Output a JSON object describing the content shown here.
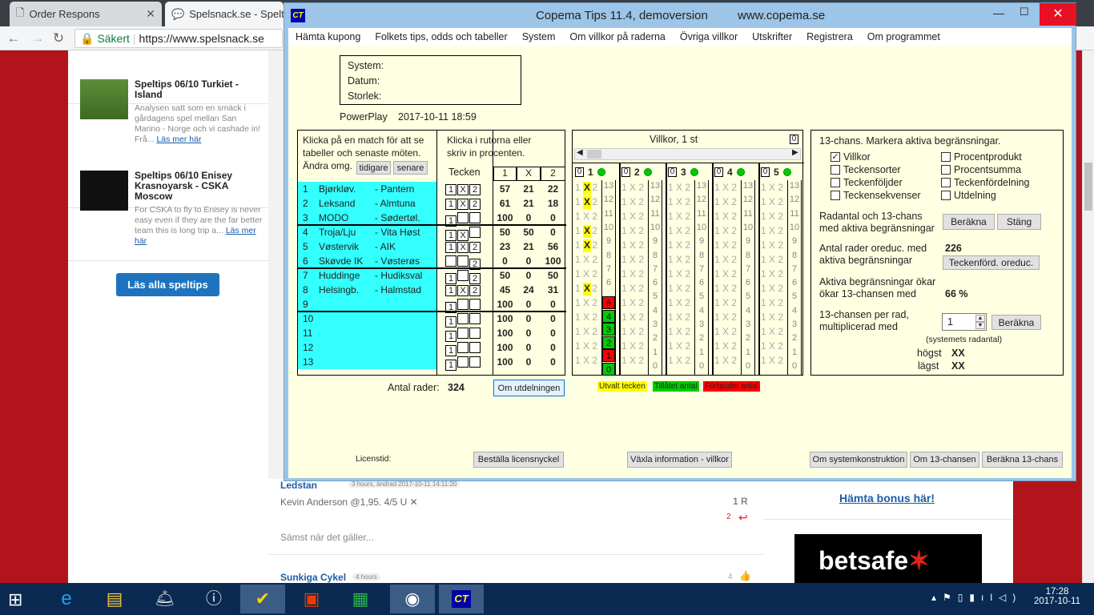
{
  "browser": {
    "tabs": [
      {
        "title": "Order Respons"
      },
      {
        "title": "Spelsnack.se - Speltips"
      }
    ],
    "secure_label": "Säkert",
    "url": "https://www.spelsnack.se"
  },
  "news": [
    {
      "title": "Speltips 06/10 Turkiet - Island",
      "excerpt": "Analysen satt som en smäck i gårdagens spel mellan San Marino - Norge och vi cashade in! Frå...",
      "more": "Läs mer här"
    },
    {
      "title": "Speltips 06/10 Enisey Krasnoyarsk - CSKA Moscow",
      "excerpt": "For CSKA to fly to Enisey is never easy even if they are the far better team this is long trip a...",
      "more": "Läs mer här"
    }
  ],
  "read_all": "Läs alla speltips",
  "comments": [
    {
      "author": "Ledstan",
      "meta": "3 hours, ändrad 2017-10-11 14:11:20",
      "text": "Kevin Anderson @1,95. 4/5 U",
      "reply": "1 R",
      "count": "2"
    },
    {
      "text": "Sämst när det gäller..."
    },
    {
      "author": "Sunkiga Cykel",
      "meta": "4 hours",
      "count": "4"
    }
  ],
  "ad": {
    "link": "Hämta bonus här!",
    "brand": "betsafe"
  },
  "app": {
    "logo": "CT",
    "title": "Copema Tips 11.4, demoversion",
    "site": "www.copema.se",
    "menu": [
      "Hämta kupong",
      "Folkets tips, odds och tabeller",
      "System",
      "Om villkor på raderna",
      "Övriga villkor",
      "Utskrifter",
      "Registrera",
      "Om programmet"
    ],
    "system_box": {
      "system": "System:",
      "datum": "Datum:",
      "storlek": "Storlek:"
    },
    "game": "PowerPlay",
    "datetime": "2017-10-11  18:59",
    "instructions_left": "Klicka på en match för att se tabeller och senaste möten. Ändra omg.",
    "btn_earlier": "tidigare",
    "btn_later": "senare",
    "instructions_mid": "Klicka i rutorna eller skriv in procenten.",
    "col_tecken": "Tecken",
    "col_1": "1",
    "col_x": "X",
    "col_2": "2",
    "matches": [
      {
        "n": "1",
        "home": "Bjørkløv.",
        "away": "- Pantern",
        "sel": [
          "1",
          "X",
          "2"
        ],
        "p1": "57",
        "px": "21",
        "p2": "22"
      },
      {
        "n": "2",
        "home": "Leksand",
        "away": "- Almtuna",
        "sel": [
          "1",
          "X",
          "2"
        ],
        "p1": "61",
        "px": "21",
        "p2": "18"
      },
      {
        "n": "3",
        "home": "MODO",
        "away": "- Sødertøl.",
        "sel": [
          "1",
          "",
          ""
        ],
        "p1": "100",
        "px": "0",
        "p2": "0"
      },
      {
        "n": "4",
        "home": "Troja/Lju",
        "away": "- Vita Høst",
        "sel": [
          "1",
          "X",
          ""
        ],
        "p1": "50",
        "px": "50",
        "p2": "0"
      },
      {
        "n": "5",
        "home": "Vøstervik",
        "away": "- AIK",
        "sel": [
          "1",
          "X",
          "2"
        ],
        "p1": "23",
        "px": "21",
        "p2": "56"
      },
      {
        "n": "6",
        "home": "Skøvde IK",
        "away": "- Vøsterøs",
        "sel": [
          "",
          "",
          "2"
        ],
        "p1": "0",
        "px": "0",
        "p2": "100"
      },
      {
        "n": "7",
        "home": "Huddinge",
        "away": "- Hudiksval",
        "sel": [
          "1",
          "",
          "2"
        ],
        "p1": "50",
        "px": "0",
        "p2": "50"
      },
      {
        "n": "8",
        "home": "Helsingb.",
        "away": "- Halmstad",
        "sel": [
          "1",
          "X",
          "2"
        ],
        "p1": "45",
        "px": "24",
        "p2": "31"
      },
      {
        "n": "9",
        "home": "",
        "away": "",
        "sel": [
          "1",
          "",
          ""
        ],
        "p1": "100",
        "px": "0",
        "p2": "0"
      },
      {
        "n": "10",
        "home": "",
        "away": "",
        "sel": [
          "1",
          "",
          ""
        ],
        "p1": "100",
        "px": "0",
        "p2": "0"
      },
      {
        "n": "11",
        "home": "",
        "away": "",
        "sel": [
          "1",
          "",
          ""
        ],
        "p1": "100",
        "px": "0",
        "p2": "0"
      },
      {
        "n": "12",
        "home": "",
        "away": "",
        "sel": [
          "1",
          "",
          ""
        ],
        "p1": "100",
        "px": "0",
        "p2": "0"
      },
      {
        "n": "13",
        "home": "",
        "away": "",
        "sel": [
          "1",
          "",
          ""
        ],
        "p1": "100",
        "px": "0",
        "p2": "0"
      }
    ],
    "antal_rader_label": "Antal rader:",
    "antal_rader": "324",
    "btn_utdelning": "Om utdelningen",
    "villkor_title": "Villkor,   1 st",
    "villkor_count": "0",
    "villkor_groups": [
      {
        "box": "0",
        "label": "1"
      },
      {
        "box": "0",
        "label": "2"
      },
      {
        "box": "0",
        "label": "3"
      },
      {
        "box": "0",
        "label": "4"
      },
      {
        "box": "0",
        "label": "5"
      }
    ],
    "villkor_cell": "1 X 2",
    "villkor_counts": [
      "13",
      "12",
      "11",
      "10",
      "9",
      "8",
      "7",
      "6",
      "5",
      "4",
      "3",
      "2",
      "1",
      "0"
    ],
    "highlight_x": [
      "X",
      "X",
      "X",
      "X",
      "X"
    ],
    "bar_red": [
      "6",
      "1"
    ],
    "bar_green": [
      "4",
      "3",
      "2",
      "0"
    ],
    "legend": {
      "yellow": "Utvalt tecken",
      "green": "Tillåtet antal",
      "red": "Förbjudet antal"
    },
    "right": {
      "heading": "13-chans. Markera aktiva begränsningar.",
      "checks": [
        {
          "label": "Villkor",
          "checked": true
        },
        {
          "label": "Procentprodukt",
          "checked": false
        },
        {
          "label": "Teckensorter",
          "checked": false
        },
        {
          "label": "Procentsumma",
          "checked": false
        },
        {
          "label": "Teckenföljder",
          "checked": false
        },
        {
          "label": "Teckenfördelning",
          "checked": false
        },
        {
          "label": "Teckensekvenser",
          "checked": false
        },
        {
          "label": "Utdelning",
          "checked": false
        }
      ],
      "radantal_label": "Radantal och 13-chans med aktiva begränsningar",
      "btn_berakna": "Beräkna",
      "btn_stang": "Stäng",
      "oreduc_label": "Antal rader oreduc. med aktiva begränsningar",
      "oreduc_value": "226",
      "btn_teckenford": "Teckenförd. oreduc.",
      "okar_label": "Aktiva begränsningar ökar ökar 13-chansen med",
      "okar_value": "66 %",
      "per_rad_label": "13-chansen per rad, multiplicerad med",
      "per_rad_value": "1",
      "btn_berakna2": "Beräkna",
      "systemets": "(systemets radantal)",
      "hogst_label": "högst",
      "hogst_value": "XX",
      "lagst_label": "lägst",
      "lagst_value": "XX"
    },
    "licenstid": "Licenstid:",
    "btn_bestalla": "Beställa licensnyckel",
    "btn_vaxla": "Växla information - villkor",
    "btn_systemkonstr": "Om systemkonstruktion",
    "btn_om13": "Om 13-chansen",
    "btn_berakna13": "Beräkna 13-chans"
  },
  "tray": {
    "time": "17:28",
    "date": "2017-10-11"
  },
  "colors": {
    "accent": "#1e73be",
    "cyan": "#33ffff",
    "yellow": "#ffff00",
    "green": "#00cc00",
    "red": "#ff0000",
    "window": "#ffffe1"
  }
}
